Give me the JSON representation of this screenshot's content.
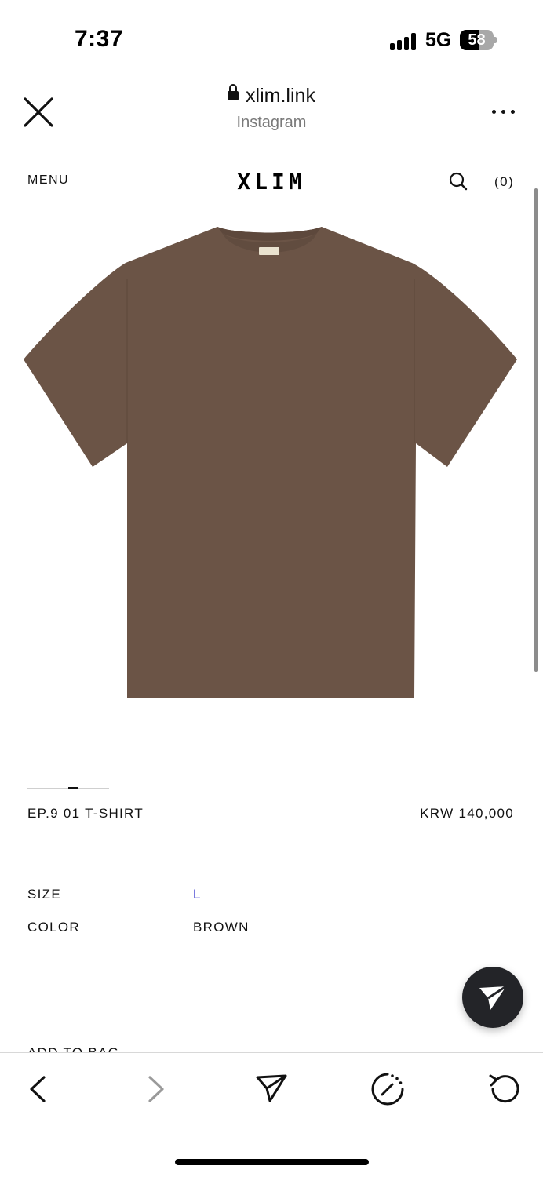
{
  "status_bar": {
    "time": "7:37",
    "network": "5G",
    "battery": "58",
    "battery_level": 0.58
  },
  "browser": {
    "domain": "xlim.link",
    "source": "Instagram",
    "icons": [
      "close-icon",
      "lock-icon",
      "more-icon"
    ]
  },
  "site_nav": {
    "menu": "MENU",
    "logo": "XLIM",
    "cart": "(0)",
    "icons": [
      "search-icon"
    ]
  },
  "product": {
    "image_alt": "brown t-shirt",
    "color_hex": "#6b5446",
    "name": "EP.9 01 T-SHIRT",
    "price": "KRW 140,000",
    "options": {
      "size_label": "SIZE",
      "size_value": "L",
      "color_label": "COLOR",
      "color_value": "BROWN"
    },
    "add_to_bag": "ADD TO BAG"
  },
  "colors": {
    "accent_link": "#2424c8",
    "fab_background": "#232428"
  },
  "toolbar": {
    "icons": [
      "back-icon",
      "forward-icon",
      "share-icon",
      "speed-icon",
      "reload-icon"
    ]
  }
}
